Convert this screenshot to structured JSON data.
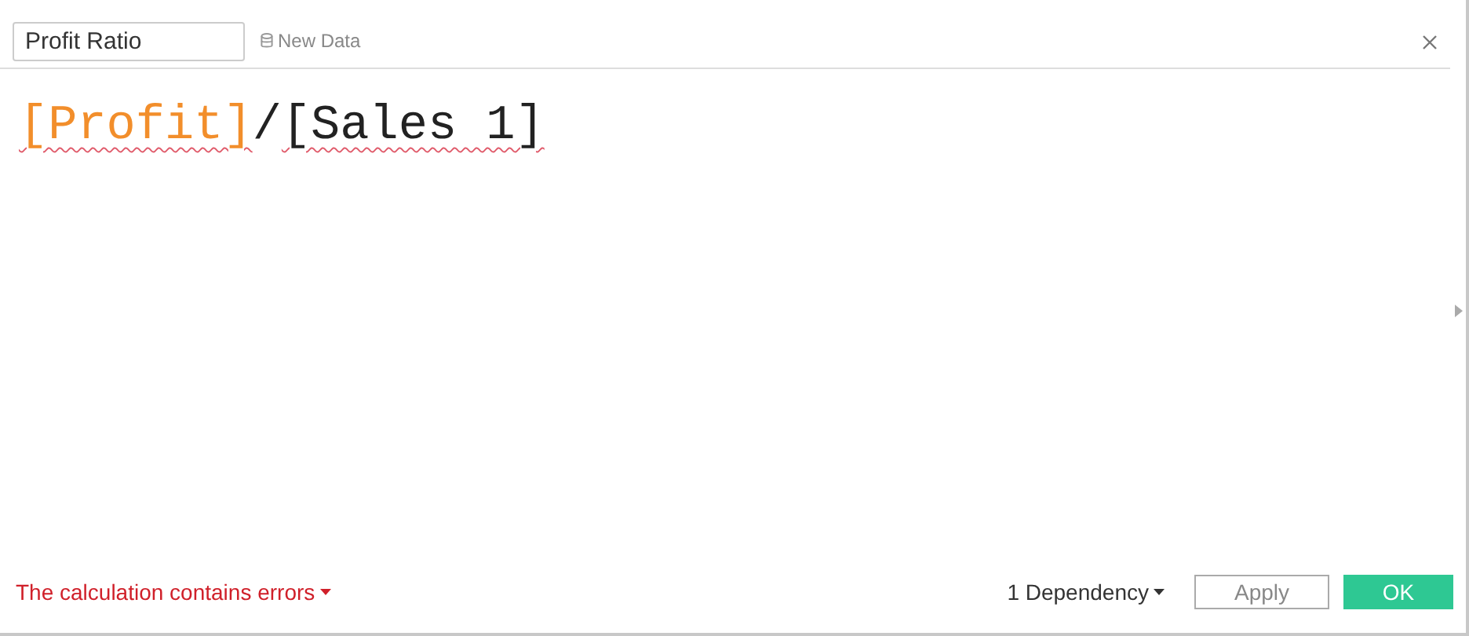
{
  "calculation": {
    "name": "Profit Ratio",
    "data_source": "New Data"
  },
  "formula": [
    {
      "kind": "field",
      "text": "[Profit]",
      "error": true
    },
    {
      "kind": "operator",
      "text": "/",
      "error": false
    },
    {
      "kind": "unknown_field",
      "text": "[Sales 1]",
      "error": true
    }
  ],
  "status": {
    "text": "The calculation contains errors",
    "error": true
  },
  "dependency": "1 Dependency",
  "buttons": [
    {
      "label": "Apply",
      "kind": "secondary",
      "disabled": true
    },
    {
      "label": "OK",
      "kind": "primary",
      "disabled": false
    }
  ]
}
